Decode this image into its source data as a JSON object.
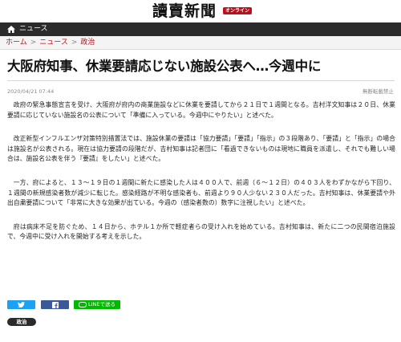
{
  "brand": {
    "logo_text": "讀賣新聞",
    "badge": "オンライン"
  },
  "nav": {
    "section_label": "ニュース",
    "icon": "home-icon"
  },
  "breadcrumb": {
    "items": [
      "ホーム",
      "ニュース",
      "政治"
    ],
    "separator": ">"
  },
  "article": {
    "headline": "大阪府知事、休業要請応じない施設公表へ…今週中に",
    "date": "2020/04/21 07:44",
    "copyright": "無断転載禁止",
    "paragraphs": [
      "政府の緊急事態宣言を受け、大阪府が府内の商業施設などに休業を要請してから２１日で１週間となる。吉村洋文知事は２０日、休業要請に応じていない施設名の公表について「準備に入っている。今週中にやりたい」と述べた。",
      "改正新型インフルエンザ対策特別措置法では、施設休業の要請は「協力要請」「要請」「指示」の３段階あり、「要請」と「指示」の場合は施設名が公表される。現在は協力要請の段階だが、吉村知事は記者団に「看過できないものは現地に職員を派遣し、それでも難しい場合は、施設名公表を伴う『要請』をしたい」と述べた。",
      "一方、府によると、１３〜１９日の１週間に新たに感染した人は４００人で、前週（６〜１２日）の４０３人をわずかながら下回り、１週間の新規感染者数が減少に転じた。感染経路が不明な感染者も、前週より９０人少ない２３０人だった。吉村知事は、休業要請や外出自粛要請について「非常に大きな効果が出ている。今週の（感染者数の）数字に注視したい」と述べた。",
      "府は病床不足を防ぐため、１４日から、ホテル１か所で軽症者らの受け入れを始めている。吉村知事は、新たに二つの民間宿泊施設で、今週中に受け入れを開始する考えを示した。"
    ]
  },
  "share": {
    "twitter_icon": "twitter-icon",
    "facebook_icon": "facebook-icon",
    "line_label": "LINEで送る",
    "colors": {
      "twitter": "#1da1f2",
      "facebook": "#3b5998",
      "line": "#00b900"
    }
  },
  "tags": [
    "政治"
  ],
  "colors": {
    "accent": "#b8111b",
    "navbar": "#2b2b2b"
  }
}
